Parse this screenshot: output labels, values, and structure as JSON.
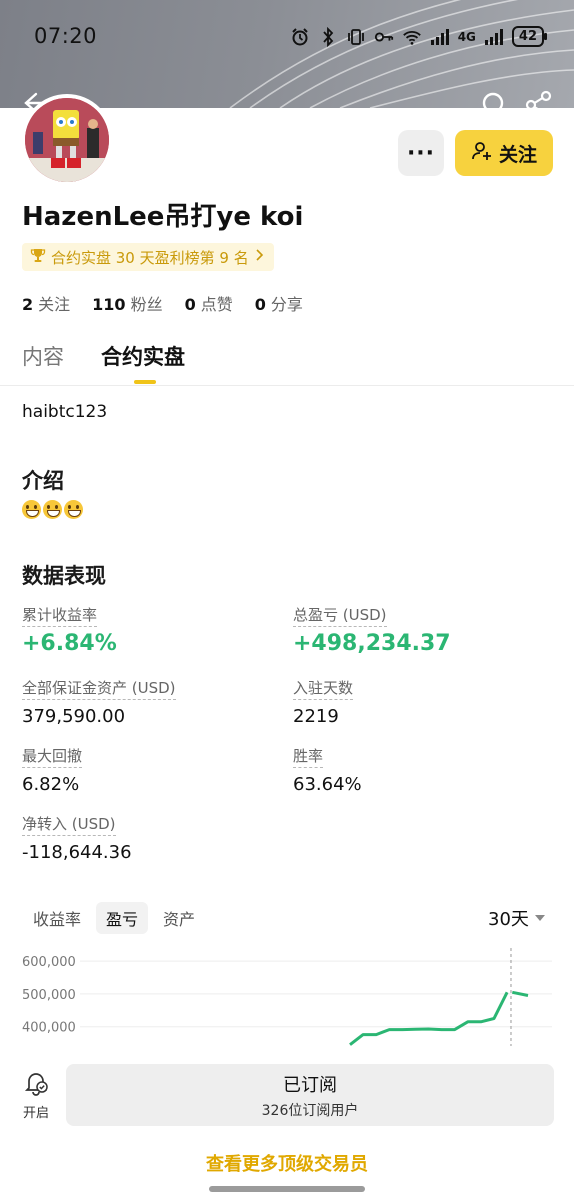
{
  "status_bar": {
    "time": "07:20",
    "battery": "42",
    "network": "4G",
    "icons": [
      "alarm-icon",
      "bluetooth-icon",
      "vibrate-icon",
      "key-icon",
      "wifi-icon",
      "signal-icon"
    ]
  },
  "nav": {
    "icons": [
      "back-arrow-icon",
      "search-icon",
      "share-icon"
    ]
  },
  "profile": {
    "name": "HazenLee吊打ye koi",
    "rank_badge": "合约实盘 30 天盈利榜第 9 名",
    "more_label": "···",
    "follow_label": "关注",
    "stats": [
      {
        "value": "2",
        "label": "关注"
      },
      {
        "value": "110",
        "label": "粉丝"
      },
      {
        "value": "0",
        "label": "点赞"
      },
      {
        "value": "0",
        "label": "分享"
      }
    ]
  },
  "tabs": [
    {
      "label": "内容",
      "active": false
    },
    {
      "label": "合约实盘",
      "active": true
    }
  ],
  "handle": "haibtc123",
  "intro": {
    "title": "介绍",
    "emoji_count": 3
  },
  "performance": {
    "title": "数据表现",
    "metrics": {
      "cumulative_return": {
        "label": "累计收益率",
        "value": "+6.84%"
      },
      "total_pnl": {
        "label": "总盈亏 (USD)",
        "value": "+498,234.37"
      },
      "margin_assets": {
        "label": "全部保证金资产 (USD)",
        "value": "379,590.00"
      },
      "days_joined": {
        "label": "入驻天数",
        "value": "2219"
      },
      "max_drawdown": {
        "label": "最大回撤",
        "value": "6.82%"
      },
      "win_rate": {
        "label": "胜率",
        "value": "63.64%"
      },
      "net_transfer": {
        "label": "净转入 (USD)",
        "value": "-118,644.36"
      }
    }
  },
  "chart_tabs": [
    {
      "label": "收益率",
      "active": false
    },
    {
      "label": "盈亏",
      "active": true
    },
    {
      "label": "资产",
      "active": false
    }
  ],
  "range_select": "30天",
  "chart_data": {
    "type": "line",
    "title": "",
    "xlabel": "",
    "ylabel": "",
    "y_tick_labels": [
      "600,000",
      "500,000",
      "400,000"
    ],
    "y_ticks": [
      600000,
      500000,
      400000
    ],
    "ylim": [
      400000,
      600000
    ],
    "visible_ylim": [
      335000,
      640000
    ],
    "x_range": [
      0,
      23
    ],
    "grid": true,
    "legend": "none",
    "line_color": "#2bb673",
    "series": [
      {
        "values": [
          {
            "x": 0,
            "y": 345000
          },
          {
            "x": 1,
            "y": 376000
          },
          {
            "x": 2,
            "y": 376000
          },
          {
            "x": 3,
            "y": 391000
          },
          {
            "x": 4,
            "y": 391000
          },
          {
            "x": 5,
            "y": 392000
          },
          {
            "x": 6,
            "y": 393000
          },
          {
            "x": 7,
            "y": 391000
          },
          {
            "x": 8,
            "y": 391000
          },
          {
            "x": 9,
            "y": 415000
          },
          {
            "x": 10,
            "y": 415000
          },
          {
            "x": 11,
            "y": 425000
          },
          {
            "x": 12,
            "y": 505000
          }
        ]
      },
      {
        "values": [
          {
            "x": 12.4,
            "y": 505000
          },
          {
            "x": 13.6,
            "y": 495000
          }
        ]
      }
    ],
    "crosshair_x": 12.3
  },
  "bottom": {
    "alert_label": "开启",
    "subscribe_title": "已订阅",
    "subscribe_sub": "326位订阅用户",
    "more_link": "查看更多顶级交易员"
  }
}
